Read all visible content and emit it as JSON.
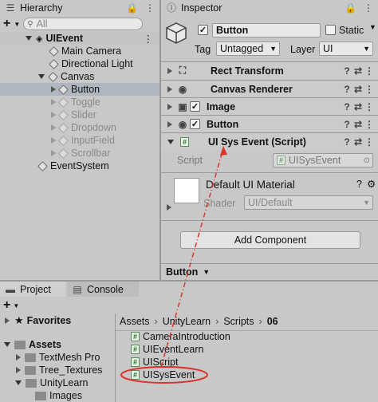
{
  "hierarchy": {
    "tab_label": "Hierarchy",
    "search_placeholder": "All",
    "scene": "UIEvent",
    "items": [
      {
        "label": "Main Camera"
      },
      {
        "label": "Directional Light"
      },
      {
        "label": "Canvas"
      },
      {
        "label": "Button"
      },
      {
        "label": "Toggle"
      },
      {
        "label": "Slider"
      },
      {
        "label": "Dropdown"
      },
      {
        "label": "InputField"
      },
      {
        "label": "Scrollbar"
      },
      {
        "label": "EventSystem"
      }
    ]
  },
  "inspector": {
    "tab_label": "Inspector",
    "object_name": "Button",
    "static_label": "Static",
    "tag_label": "Tag",
    "tag_value": "Untagged",
    "layer_label": "Layer",
    "layer_value": "UI",
    "components": [
      {
        "label": "Rect Transform"
      },
      {
        "label": "Canvas Renderer"
      },
      {
        "label": "Image"
      },
      {
        "label": "Button"
      },
      {
        "label": "UI Sys Event (Script)"
      }
    ],
    "script_label": "Script",
    "script_value": "UISysEvent",
    "material_name": "Default UI Material",
    "shader_label": "Shader",
    "shader_value": "UI/Default",
    "add_component_label": "Add Component",
    "footer_label": "Button"
  },
  "project": {
    "tab_project": "Project",
    "tab_console": "Console",
    "favorites_label": "Favorites",
    "assets_label": "Assets",
    "tree": [
      {
        "label": "TextMesh Pro"
      },
      {
        "label": "Tree_Textures"
      },
      {
        "label": "UnityLearn"
      },
      {
        "label": "Images"
      }
    ],
    "breadcrumb": [
      "Assets",
      "UnityLearn",
      "Scripts",
      "06"
    ],
    "files": [
      {
        "label": "CameraIntroduction"
      },
      {
        "label": "UIEventLearn"
      },
      {
        "label": "UIScript"
      },
      {
        "label": "UISysEvent"
      }
    ]
  },
  "colors": {
    "annotation": "#d9332c",
    "selection": "#b0b6c0"
  }
}
